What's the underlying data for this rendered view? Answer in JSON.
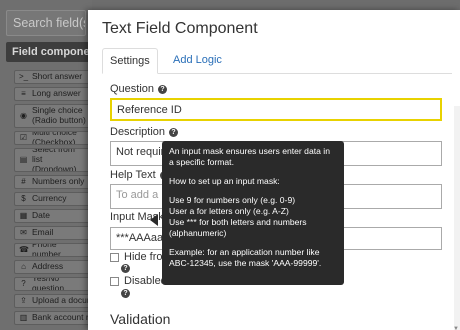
{
  "sidebar": {
    "search_placeholder": "Search field(s)",
    "group_title": "Field components",
    "items": [
      {
        "icon": ">_",
        "label": "Short answer"
      },
      {
        "icon": "≡",
        "label": "Long answer"
      },
      {
        "icon": "◉",
        "label": "Single choice (Radio button)"
      },
      {
        "icon": "☑",
        "label": "Multi choice (Checkbox)"
      },
      {
        "icon": "▤",
        "label": "Select from list (Dropdown)"
      },
      {
        "icon": "#",
        "label": "Numbers only"
      },
      {
        "icon": "$",
        "label": "Currency"
      },
      {
        "icon": "▦",
        "label": "Date"
      },
      {
        "icon": "✉",
        "label": "Email"
      },
      {
        "icon": "☎",
        "label": "Phone number"
      },
      {
        "icon": "⌂",
        "label": "Address"
      },
      {
        "icon": "?",
        "label": "Yes/No question"
      },
      {
        "icon": "⇪",
        "label": "Upload a document"
      },
      {
        "icon": "▥",
        "label": "Bank account number"
      }
    ]
  },
  "modal": {
    "title": "Text Field Component",
    "tabs": {
      "settings": "Settings",
      "add_logic": "Add Logic"
    },
    "question": {
      "label": "Question",
      "value": "Reference ID"
    },
    "description": {
      "label": "Description",
      "value": "Not required"
    },
    "help_text": {
      "label": "Help Text",
      "placeholder": "To add a help"
    },
    "input_mask": {
      "label": "Input Mask",
      "value": "***AAAaaa9"
    },
    "hide_from": {
      "label": "Hide from v"
    },
    "disabled": {
      "label": "Disabled"
    },
    "section": "Validation"
  },
  "tooltip": {
    "intro": "An input mask ensures users enter data in a specific format.",
    "howto": "How to set up an input mask:",
    "rule1": "Use 9 for numbers only (e.g. 0-9)",
    "rule2": "User a for letters only (e.g. A-Z)",
    "rule3": "Use *** for both letters and numbers (alphanumeric)",
    "example": "Example: for an application number like ABC-12345, use the mask 'AAA-99999'."
  }
}
